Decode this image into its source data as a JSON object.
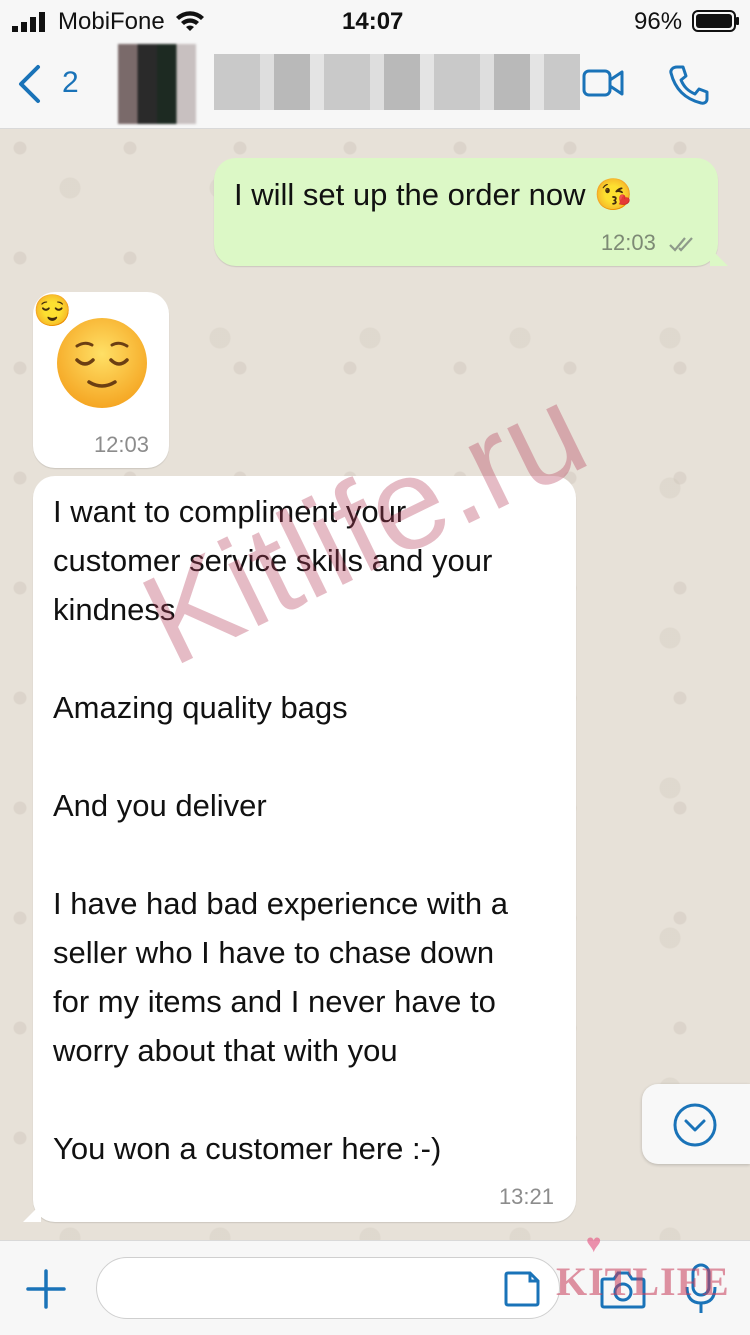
{
  "status_bar": {
    "carrier": "MobiFone",
    "time": "14:07",
    "battery": "96%"
  },
  "header": {
    "back_count": "2",
    "contact_name": "",
    "icons": [
      "chevron-left-icon",
      "video-call-icon",
      "phone-icon"
    ],
    "accent_color": "#1a73b8"
  },
  "messages": [
    {
      "direction": "outgoing",
      "text": "I will set up the order now 😘",
      "time": "12:03",
      "status": "delivered"
    },
    {
      "direction": "incoming",
      "emoji": "😌",
      "time": "12:03"
    },
    {
      "direction": "incoming",
      "lines": [
        "I want to compliment your",
        "customer service skills and your",
        "kindness",
        "",
        "Amazing quality bags",
        "",
        "And you deliver",
        "",
        "I have had bad experience with a",
        "seller who I have to chase down",
        "for my items and I never have to",
        "worry about that with you",
        "",
        "You won a customer here :-)"
      ],
      "time": "13:21"
    }
  ],
  "watermark": "Kitlife.ru",
  "logo_watermark": "KITLIFE",
  "input": {
    "placeholder": "",
    "value": ""
  },
  "colors": {
    "outgoing_bubble": "#dcf8c6",
    "incoming_bubble": "#ffffff",
    "wallpaper": "#e7e1d8"
  }
}
